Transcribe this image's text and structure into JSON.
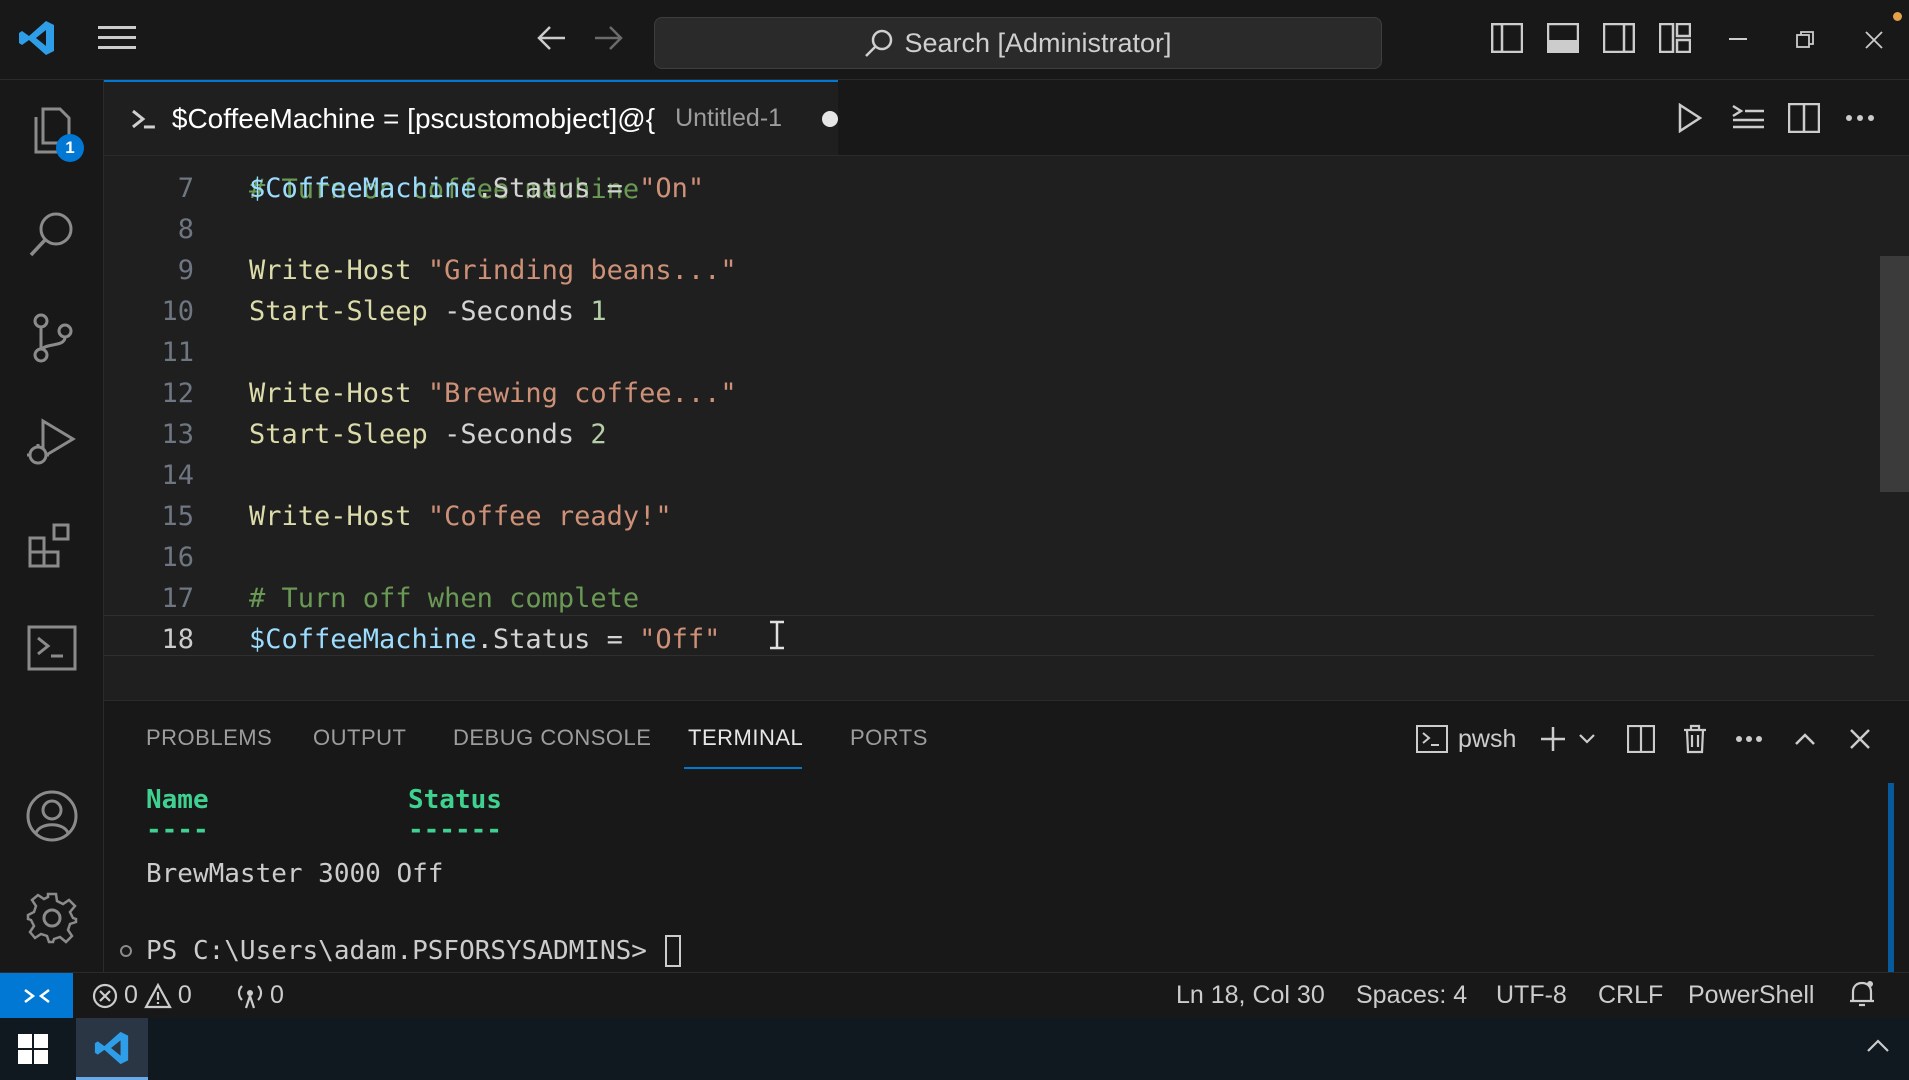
{
  "titlebar": {
    "search_text": "Search [Administrator]"
  },
  "activity": {
    "explorer_badge": "1"
  },
  "tab": {
    "title": "$CoffeeMachine = [pscustomobject]@{",
    "description": "Untitled-1"
  },
  "editor": {
    "partial_top_comment": "# Turn on coffee machine",
    "lines": [
      {
        "n": "7",
        "tokens": [
          [
            "var",
            "$CoffeeMachine"
          ],
          [
            "prop",
            ".Status"
          ],
          [
            "op",
            " = "
          ],
          [
            "str",
            "\"On\""
          ]
        ]
      },
      {
        "n": "8",
        "tokens": []
      },
      {
        "n": "9",
        "tokens": [
          [
            "cmd",
            "Write-Host"
          ],
          [
            "op",
            " "
          ],
          [
            "str",
            "\"Grinding beans...\""
          ]
        ]
      },
      {
        "n": "10",
        "tokens": [
          [
            "cmd",
            "Start-Sleep"
          ],
          [
            "op",
            " -Seconds "
          ],
          [
            "num",
            "1"
          ]
        ]
      },
      {
        "n": "11",
        "tokens": []
      },
      {
        "n": "12",
        "tokens": [
          [
            "cmd",
            "Write-Host"
          ],
          [
            "op",
            " "
          ],
          [
            "str",
            "\"Brewing coffee...\""
          ]
        ]
      },
      {
        "n": "13",
        "tokens": [
          [
            "cmd",
            "Start-Sleep"
          ],
          [
            "op",
            " -Seconds "
          ],
          [
            "num",
            "2"
          ]
        ]
      },
      {
        "n": "14",
        "tokens": []
      },
      {
        "n": "15",
        "tokens": [
          [
            "cmd",
            "Write-Host"
          ],
          [
            "op",
            " "
          ],
          [
            "str",
            "\"Coffee ready!\""
          ]
        ]
      },
      {
        "n": "16",
        "tokens": []
      },
      {
        "n": "17",
        "tokens": [
          [
            "com",
            "# Turn off when complete"
          ]
        ]
      },
      {
        "n": "18",
        "tokens": [
          [
            "var",
            "$CoffeeMachine"
          ],
          [
            "prop",
            ".Status"
          ],
          [
            "op",
            " = "
          ],
          [
            "str",
            "\"Off\""
          ]
        ]
      }
    ]
  },
  "panel": {
    "tabs": [
      "PROBLEMS",
      "OUTPUT",
      "DEBUG CONSOLE",
      "TERMINAL",
      "PORTS"
    ],
    "shell_name": "pwsh",
    "terminal": {
      "col_name": "Name",
      "col_status": "Status",
      "sep_name": "----",
      "sep_status": "------",
      "row": "BrewMaster 3000 Off",
      "prompt": "PS C:\\Users\\adam.PSFORSYSADMINS> "
    }
  },
  "statusbar": {
    "errors": "0",
    "warnings": "0",
    "ports": "0",
    "position": "Ln 18, Col 30",
    "spaces": "Spaces: 4",
    "encoding": "UTF-8",
    "eol": "CRLF",
    "language": "PowerShell"
  },
  "colors": {
    "accent": "#0078d4",
    "terminal_header": "#3fd18f"
  }
}
